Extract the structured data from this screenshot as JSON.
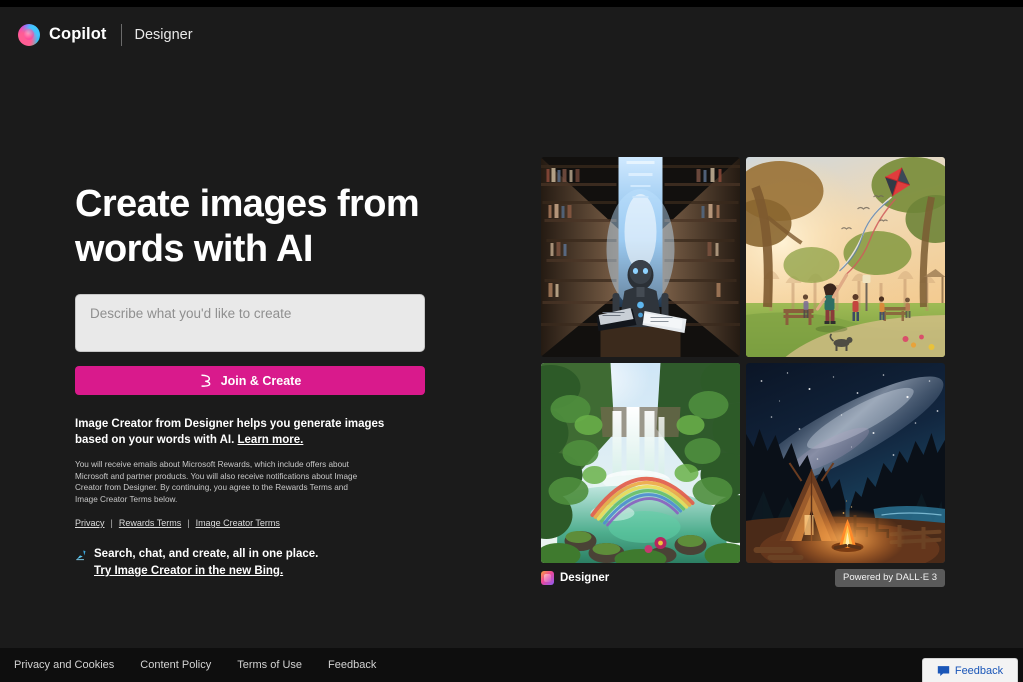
{
  "header": {
    "brand": "Copilot",
    "sub_brand": "Designer",
    "logo_icon": "copilot-logo-icon"
  },
  "hero": {
    "headline": "Create images from words with AI",
    "input_placeholder": "Describe what you'd like to create",
    "input_value": "",
    "cta_label": "Join & Create",
    "cta_icon": "brush-icon",
    "cta_color": "#d91a8c",
    "blurb": "Image Creator from Designer helps you generate images based on your words with AI.",
    "blurb_link": "Learn more.",
    "fineprint": "You will receive emails about Microsoft Rewards, which include offers about Microsoft and partner products. You will also receive notifications about Image Creator from Designer. By continuing, you agree to the Rewards Terms and Image Creator Terms below.",
    "terms_links": [
      "Privacy",
      "Rewards Terms",
      "Image Creator Terms"
    ],
    "terms_separator": "|",
    "bing_icon": "bing-logo-icon",
    "bing_line1": "Search, chat, and create, all in one place.",
    "bing_line2": "Try Image Creator in the new Bing."
  },
  "gallery": {
    "tiles": [
      {
        "name": "tile-library-robot",
        "alt": "Humanoid robot reading at a desk in a vast glowing library"
      },
      {
        "name": "tile-kite-park",
        "alt": "Child flying a red kite in a sunlit park with people"
      },
      {
        "name": "tile-waterfall-rainbow",
        "alt": "Jungle waterfall with a rainbow over a green pool"
      },
      {
        "name": "tile-campfire-night",
        "alt": "Campfire and cabin under a starry Milky Way night sky"
      }
    ],
    "designer_label": "Designer",
    "designer_logo_icon": "designer-logo-icon",
    "badge": "Powered by DALL·E 3"
  },
  "footer": {
    "links": [
      "Privacy and Cookies",
      "Content Policy",
      "Terms of Use",
      "Feedback"
    ],
    "feedback_widget": {
      "label": "Feedback",
      "icon": "speech-bubble-icon",
      "color": "#1a56b8"
    }
  }
}
